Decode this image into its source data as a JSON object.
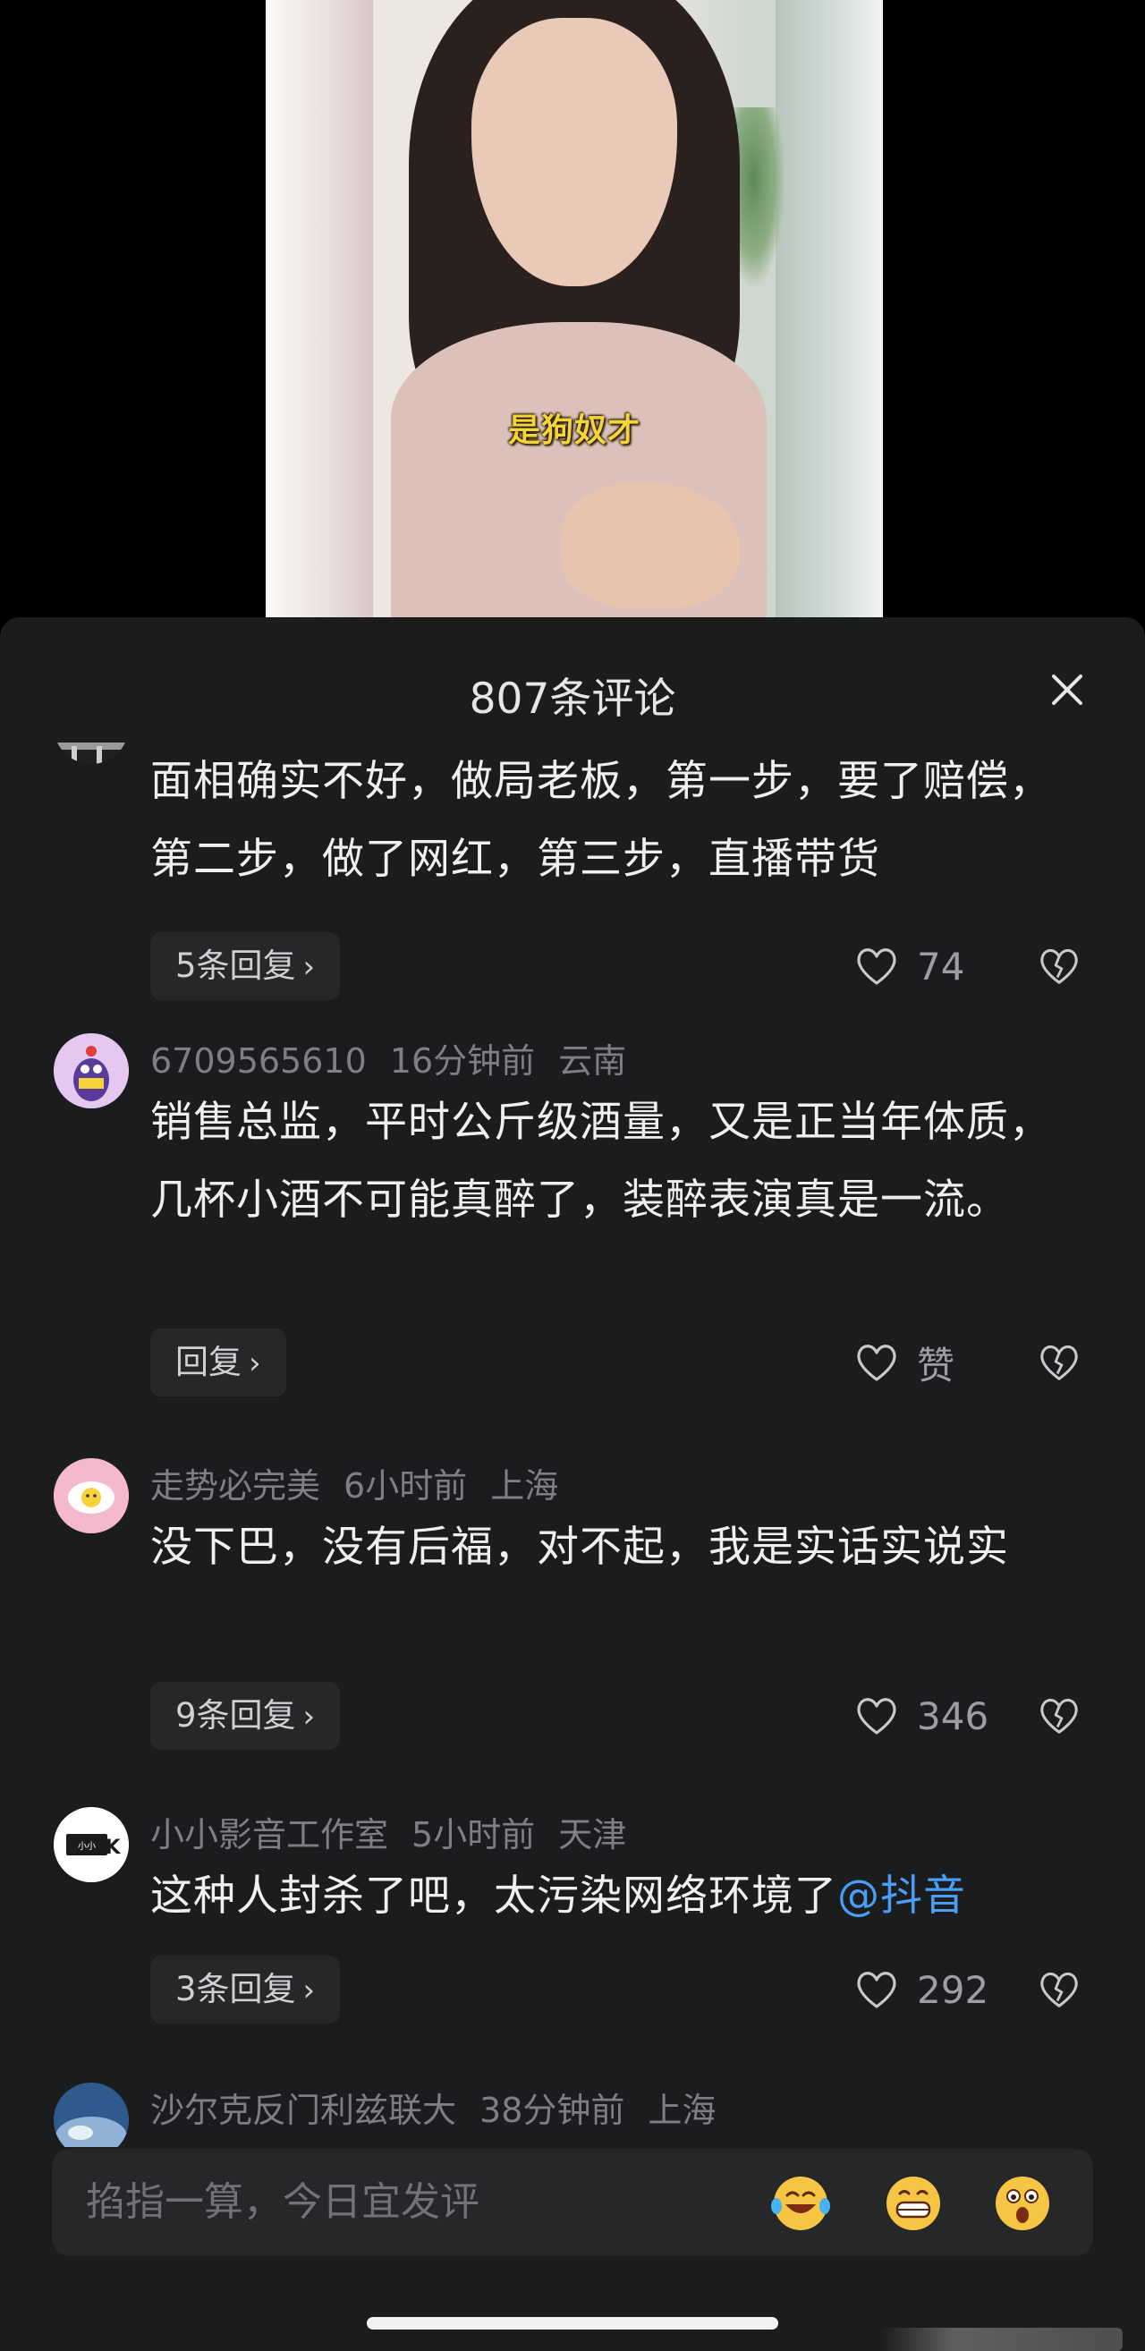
{
  "video": {
    "subtitle": "是狗奴才"
  },
  "header": {
    "title": "807条评论",
    "close_icon": "close-icon"
  },
  "comments": [
    {
      "id": "c0",
      "text": "面相确实不好，做局老板，第一步，要了赔偿，第二步，做了网红，第三步，直播带货",
      "reply_label": "5条回复",
      "likes": "74"
    },
    {
      "id": "c1",
      "user": "6709565610",
      "time": "16分钟前",
      "location": "云南",
      "text": "销售总监，平时公斤级酒量，又是正当年体质，几杯小酒不可能真醉了，装醉表演真是一流。",
      "reply_label": "回复",
      "likes": "赞"
    },
    {
      "id": "c2",
      "user": "走势必完美",
      "time": "6小时前",
      "location": "上海",
      "text": "没下巴，没有后福，对不起，我是实话实说实",
      "reply_label": "9条回复",
      "likes": "346"
    },
    {
      "id": "c3",
      "user": "小小影音工作室",
      "time": "5小时前",
      "location": "天津",
      "text": "这种人封杀了吧，太污染网络环境了",
      "mention": "@抖音",
      "reply_label": "3条回复",
      "likes": "292"
    },
    {
      "id": "c4",
      "user": "沙尔克反门利兹联大",
      "time": "38分钟前",
      "location": "上海"
    }
  ],
  "input": {
    "placeholder": "掐指一算，今日宜发评"
  },
  "emojis": [
    "laughing-crying-emoji",
    "grinning-emoji",
    "surprised-emoji"
  ],
  "colors": {
    "sheet_bg": "#1b1c1e",
    "pill_bg": "#262729",
    "meta_text": "#7d7f83",
    "mention": "#4a9ef5",
    "subtitle": "#f5d43b"
  }
}
